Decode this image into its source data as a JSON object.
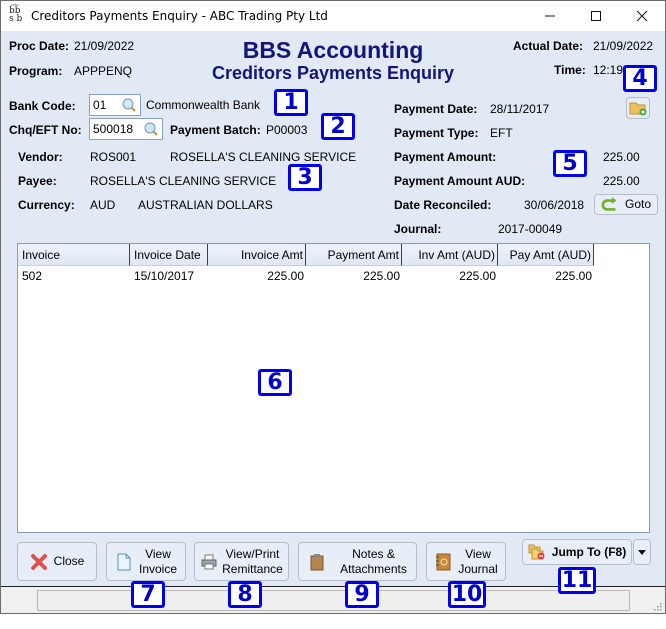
{
  "window": {
    "title": "Creditors Payments Enquiry - ABC Trading Pty Ltd",
    "app_icon": "bbs-logo-icon",
    "controls": {
      "minimize": "minimize-icon",
      "maximize": "maximize-icon",
      "close": "close-icon"
    }
  },
  "header": {
    "proc_date_label": "Proc Date:",
    "proc_date_value": "21/09/2022",
    "program_label": "Program:",
    "program_value": "APPPENQ",
    "brand": "BBS Accounting",
    "subtitle": "Creditors Payments Enquiry",
    "actual_date_label": "Actual Date:",
    "actual_date_value": "21/09/2022",
    "time_label": "Time:",
    "time_value": "12:19"
  },
  "left": {
    "bank_code_label": "Bank Code:",
    "bank_code_value": "01",
    "bank_name": "Commonwealth Bank",
    "chq_label": "Chq/EFT No:",
    "chq_value": "500018",
    "payment_batch_label": "Payment Batch:",
    "payment_batch_value": "P00003",
    "vendor_label": "Vendor:",
    "vendor_code": "ROS001",
    "vendor_name": "ROSELLA'S CLEANING SERVICE",
    "payee_label": "Payee:",
    "payee_value": "ROSELLA'S CLEANING SERVICE",
    "currency_label": "Currency:",
    "currency_code": "AUD",
    "currency_name": "AUSTRALIAN DOLLARS"
  },
  "right": {
    "payment_date_label": "Payment Date:",
    "payment_date_value": "28/11/2017",
    "payment_type_label": "Payment Type:",
    "payment_type_value": "EFT",
    "payment_amount_label": "Payment Amount:",
    "payment_amount_value": "225.00",
    "payment_amount_aud_label": "Payment Amount AUD:",
    "payment_amount_aud_value": "225.00",
    "date_reconciled_label": "Date Reconciled:",
    "date_reconciled_value": "30/06/2018",
    "goto_label": "Goto",
    "journal_label": "Journal:",
    "journal_value": "2017-00049"
  },
  "table": {
    "columns": [
      "Invoice",
      "Invoice Date",
      "Invoice Amt",
      "Payment Amt",
      "Inv Amt (AUD)",
      "Pay Amt (AUD)"
    ],
    "rows": [
      [
        "502",
        "15/10/2017",
        "225.00",
        "225.00",
        "225.00",
        "225.00"
      ]
    ]
  },
  "buttons": {
    "close": "Close",
    "view_invoice_1": "View",
    "view_invoice_2": "Invoice",
    "remittance_1": "View/Print",
    "remittance_2": "Remittance",
    "notes_1": "Notes &",
    "notes_2": "Attachments",
    "journal_1": "View",
    "journal_2": "Journal",
    "jump_to": "Jump To (F8)"
  },
  "badges": [
    "1",
    "2",
    "3",
    "4",
    "5",
    "6",
    "7",
    "8",
    "9",
    "10",
    "11"
  ]
}
